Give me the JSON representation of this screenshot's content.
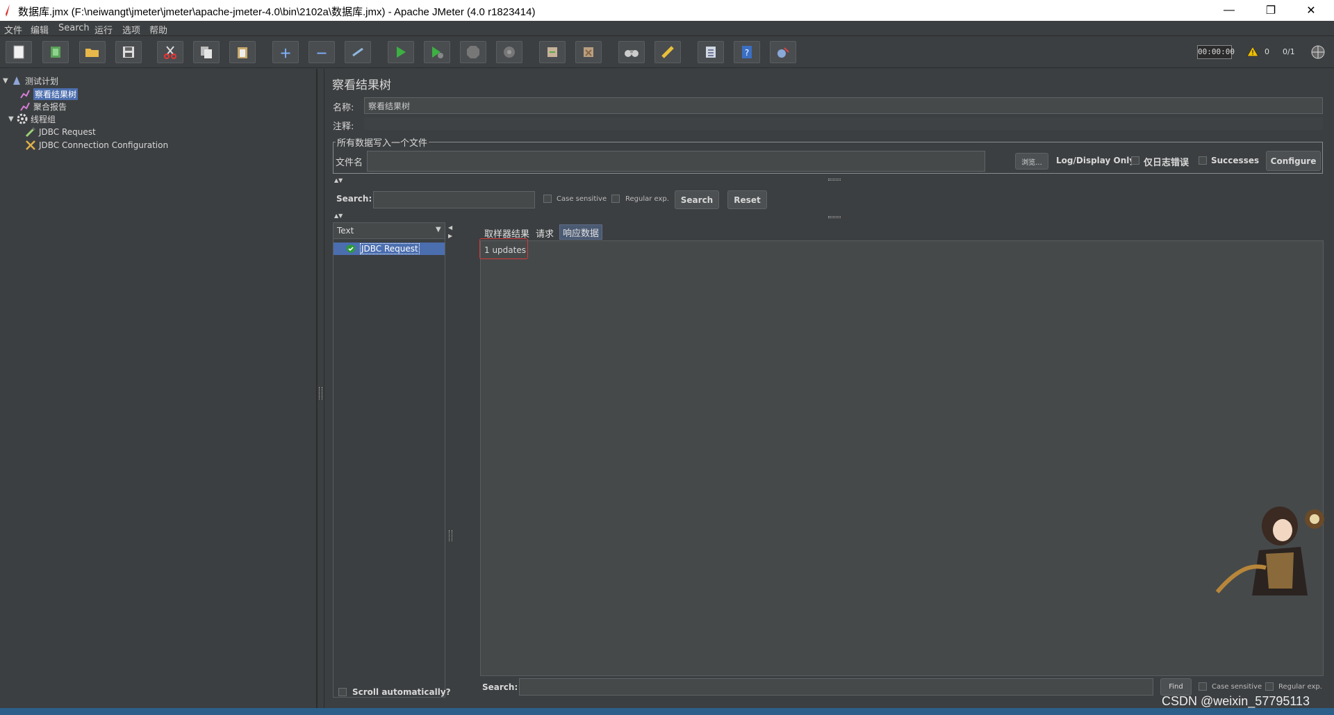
{
  "window": {
    "title": "数据库.jmx (F:\\neiwangt\\jmeter\\jmeter\\apache-jmeter-4.0\\bin\\2102a\\数据库.jmx) - Apache JMeter (4.0 r1823414)",
    "minimize": "—",
    "restore": "❐",
    "close": "✕"
  },
  "menu": [
    "文件",
    "编辑",
    "Search",
    "运行",
    "选项",
    "帮助"
  ],
  "toolbar": {
    "timer": "00:00:00",
    "warning_count": "0",
    "threads": "0/1"
  },
  "tree": {
    "root": "测试计划",
    "items": [
      "察看结果树",
      "聚合报告",
      "线程组",
      "JDBC Request",
      "JDBC Connection Configuration"
    ]
  },
  "panel": {
    "title": "察看结果树",
    "name_label": "名称:",
    "name_value": "察看结果树",
    "comment_label": "注释:",
    "comment_value": "",
    "file_group_title": "所有数据写入一个文件",
    "filename_label": "文件名",
    "filename_value": "",
    "browse": "浏览...",
    "log_display_only": "Log/Display Only:",
    "errors_only": "仅日志错误",
    "successes": "Successes",
    "configure": "Configure"
  },
  "search": {
    "label": "Search:",
    "case_sensitive": "Case sensitive",
    "regular_exp": "Regular exp.",
    "search_button": "Search",
    "reset_button": "Reset"
  },
  "results": {
    "renderer": "Text",
    "samples": [
      "JDBC Request"
    ],
    "scroll_auto": "Scroll automatically?",
    "tabs": [
      "取样器结果",
      "请求",
      "响应数据"
    ],
    "response_text": "1 updates"
  },
  "bottom_search": {
    "label": "Search:",
    "find": "Find",
    "case_sensitive": "Case sensitive",
    "regular_exp": "Regular exp."
  },
  "watermark": "CSDN @weixin_57795113",
  "colors": {
    "background": "#3c3f41",
    "selection": "#4b6eaf",
    "tree_selection": "#0d293e"
  }
}
